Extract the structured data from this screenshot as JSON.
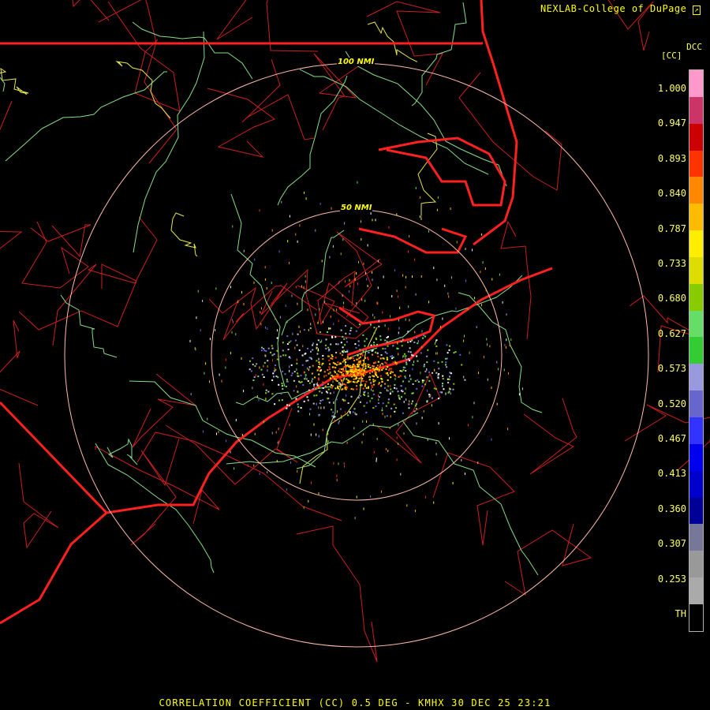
{
  "credit": "NEXLAB-College of DuPage",
  "legend": {
    "product_code": "DCC",
    "unit": "[CC]",
    "ticks": [
      "1.000",
      "0.947",
      "0.893",
      "0.840",
      "0.787",
      "0.733",
      "0.680",
      "0.627",
      "0.573",
      "0.520",
      "0.467",
      "0.413",
      "0.360",
      "0.307",
      "0.253",
      "TH"
    ],
    "colors": [
      "#ff99cc",
      "#cc3366",
      "#cc0000",
      "#ff3300",
      "#ff8800",
      "#ffbb00",
      "#ffee00",
      "#dddd00",
      "#88cc00",
      "#66dd66",
      "#33cc33",
      "#9999dd",
      "#6666cc",
      "#3333ff",
      "#0000ee",
      "#0000cc",
      "#000099",
      "#777799",
      "#999999",
      "#aaaaaa",
      "#000000"
    ]
  },
  "rings": [
    {
      "label": "100 NMI"
    },
    {
      "label": "50 NMI"
    }
  ],
  "footer": "CORRELATION COEFFICIENT (CC) 0.5 DEG - KMHX 30 DEC 25 23:21",
  "colors": {
    "state_border": "#ff2020",
    "county": "#cc1f1f",
    "highway_green": "#88dd88",
    "highway_yellow": "#e6e64d",
    "ring": "#ffbbaa",
    "text": "#ffff00"
  }
}
